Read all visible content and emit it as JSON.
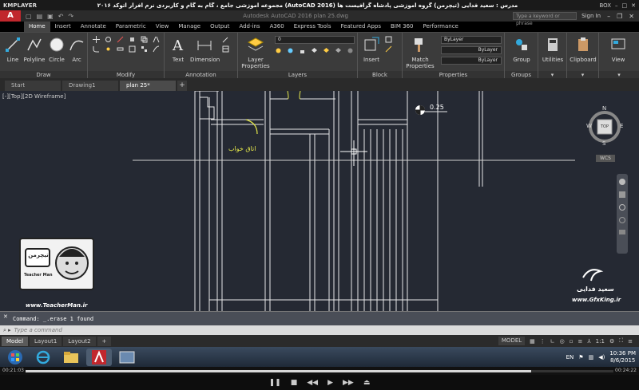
{
  "kmplayer": {
    "logo": "KMPLAYER",
    "title": "مجموعه آموزشی جامع ، گام به گام و کاربردی نرم افزار  اتوکد ۲۰۱۶ (AutoCAD 2016)  مدرس : سعید فدایی (تیچرمن) گروه آموزشی پادشاه گرافیست ها",
    "right_label": "BOX",
    "elapsed": "00:21:03",
    "total": "00:24:22",
    "progress_fraction": 0.86
  },
  "acad": {
    "logo": "A",
    "doc_title": "Autodesk AutoCAD 2016   plan 25.dwg",
    "search_placeholder": "Type a keyword or phrase",
    "signin": "Sign In"
  },
  "ribbon_tabs": [
    "Home",
    "Insert",
    "Annotate",
    "Parametric",
    "View",
    "Manage",
    "Output",
    "Add-ins",
    "A360",
    "Express Tools",
    "Featured Apps",
    "BIM 360",
    "Performance"
  ],
  "ribbon": {
    "draw_tools": [
      "Line",
      "Polyline",
      "Circle",
      "Arc"
    ],
    "draw_label": "Draw",
    "modify_label": "Modify",
    "text_label": "Text",
    "dimension_label": "Dimension",
    "annotation_label": "Annotation",
    "layer_props_label": "Layer Properties",
    "layer_value": "0",
    "layers_label": "Layers",
    "insert_label": "Insert",
    "block_label": "Block",
    "match_label": "Match Properties",
    "bylayer1": "ByLayer",
    "bylayer2": "ByLayer",
    "bylayer3": "ByLayer",
    "properties_label": "Properties",
    "group_label": "Group",
    "groups_label": "Groups",
    "utilities_label": "Utilities",
    "clipboard_label": "Clipboard",
    "view_label": "View"
  },
  "file_tabs": [
    "Start",
    "Drawing1",
    "plan 25*"
  ],
  "drawing": {
    "view_label": "[-][Top][2D Wireframe]",
    "level_text": "0.25",
    "room_label": "اتاق خواب",
    "viewcube_top": "TOP",
    "viewcube_n": "N",
    "viewcube_s": "S",
    "viewcube_e": "E",
    "viewcube_w": "W",
    "wcs": "WCS",
    "watermark_name": "سعید فدایی",
    "watermark_site": "www.GfxKing.ir",
    "teacher_site": "www.TeacherMan.ir",
    "teacher_badge_1": "تیچرمن",
    "teacher_badge_2": "Teacher Man"
  },
  "command": {
    "history": "Command: _.erase 1 found",
    "placeholder": "Type a command"
  },
  "layout_tabs": [
    "Model",
    "Layout1",
    "Layout2"
  ],
  "status": {
    "model": "MODEL",
    "scale": "1:1"
  },
  "taskbar": {
    "lang": "EN",
    "time": "10:36 PM",
    "date": "8/6/2015"
  }
}
